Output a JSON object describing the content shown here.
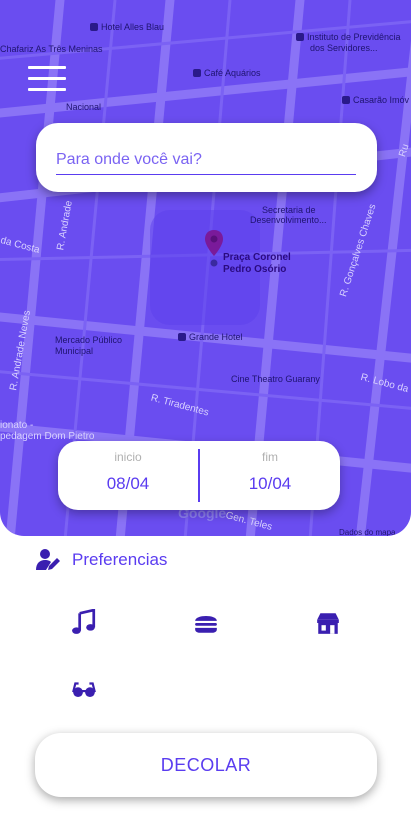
{
  "map": {
    "places": {
      "hotel_alles_blau": "Hotel Alles Blau",
      "chafariz": "Chafariz As Três Meninas",
      "instituto": "Instituto de Previdência",
      "instituto2": "dos Servidores...",
      "cafe": "Café Aquários",
      "nacional": "Nacional",
      "casarao": "Casarão Imóv",
      "secretaria": "Secretaria de",
      "secretaria2": "Desenvolvimento...",
      "praca": "Praça Coronel",
      "praca2": "Pedro Osório",
      "mercado": "Mercado Público",
      "mercado2": "Municipal",
      "grande_hotel": "Grande Hotel",
      "cine": "Cine Theatro Guarany",
      "dados": "Dados do mapa"
    },
    "streets": {
      "andrade": "R. Andrade",
      "costa": "da Costa",
      "andrade_neves": "R. Andrade Neves",
      "goncalves_chaves": "R. Gonçalves Chaves",
      "tiradentes": "R. Tiradentes",
      "lobo": "R. Lobo da",
      "gen_telles": "Gen. Teles",
      "ru": "Ru",
      "hospedagem": "ionato -",
      "hospedagem2": "pedagem Dom Pietro"
    },
    "attribution": "Google"
  },
  "search": {
    "placeholder": "Para onde você vai?"
  },
  "dates": {
    "start_label": "inicio",
    "start_value": "08/04",
    "end_label": "fim",
    "end_value": "10/04"
  },
  "preferences": {
    "title": "Preferencias",
    "icons": [
      "music-icon",
      "burger-icon",
      "store-icon",
      "glasses-icon"
    ]
  },
  "action": {
    "label": "DECOLAR"
  },
  "colors": {
    "accent": "#5a3cf0",
    "map_bg": "#6a4df0"
  }
}
